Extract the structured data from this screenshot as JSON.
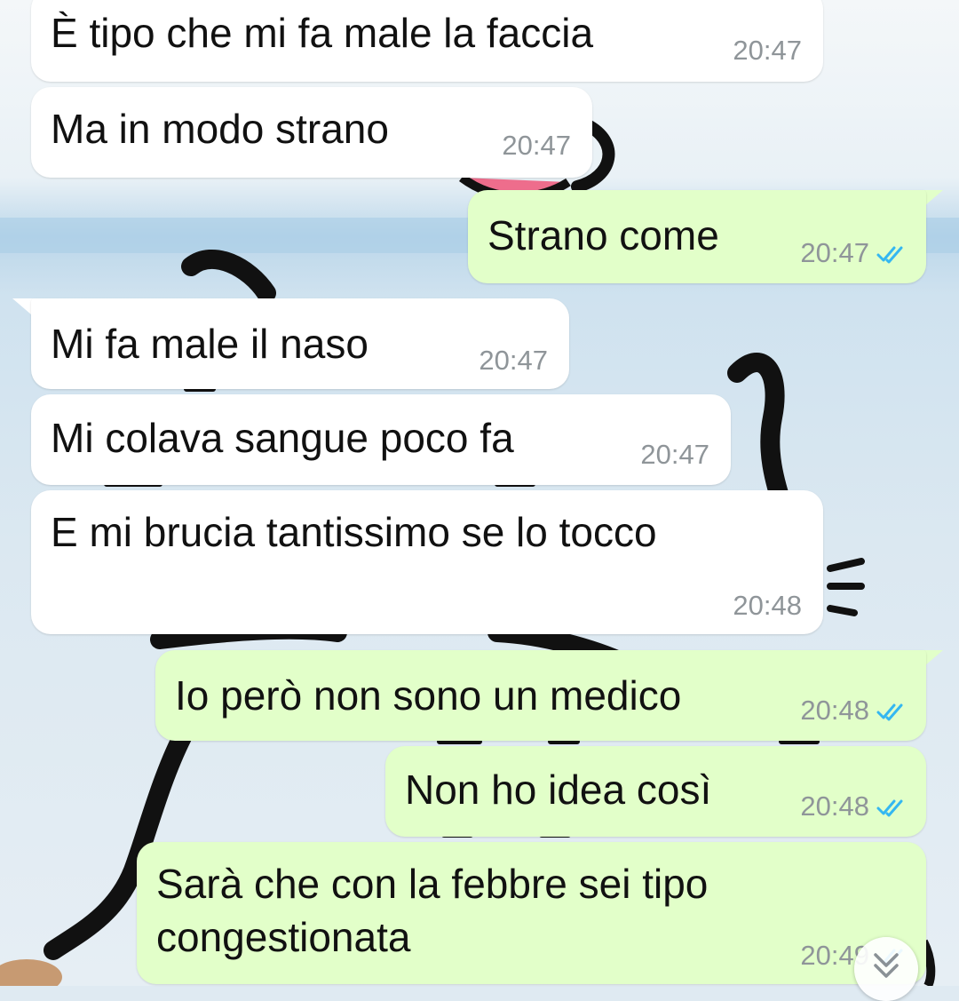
{
  "messages": [
    {
      "text": "È tipo che mi fa male la faccia",
      "time": "20:47",
      "direction": "incoming"
    },
    {
      "text": "Ma in modo strano",
      "time": "20:47",
      "direction": "incoming"
    },
    {
      "text": "Strano come",
      "time": "20:47",
      "direction": "outgoing",
      "status": "read"
    },
    {
      "text": "Mi fa male il naso",
      "time": "20:47",
      "direction": "incoming"
    },
    {
      "text": "Mi colava sangue poco fa",
      "time": "20:47",
      "direction": "incoming"
    },
    {
      "text": "E mi brucia tantissimo se lo tocco",
      "time": "20:48",
      "direction": "incoming"
    },
    {
      "text": "Io però non sono un medico",
      "time": "20:48",
      "direction": "outgoing",
      "status": "read"
    },
    {
      "text": "Non ho idea così",
      "time": "20:48",
      "direction": "outgoing",
      "status": "read"
    },
    {
      "text_line1": "Sarà che con la febbre sei tipo",
      "text_line2": "congestionata",
      "time": "20:49",
      "direction": "outgoing",
      "status": "read"
    }
  ],
  "icons": {
    "read_receipt": "double-check-icon",
    "scroll_down": "chevron-double-down-icon"
  },
  "colors": {
    "incoming_bubble": "#ffffff",
    "outgoing_bubble": "#e2ffc9",
    "timestamp": "#8f9599",
    "read_tick": "#34b7f1"
  }
}
